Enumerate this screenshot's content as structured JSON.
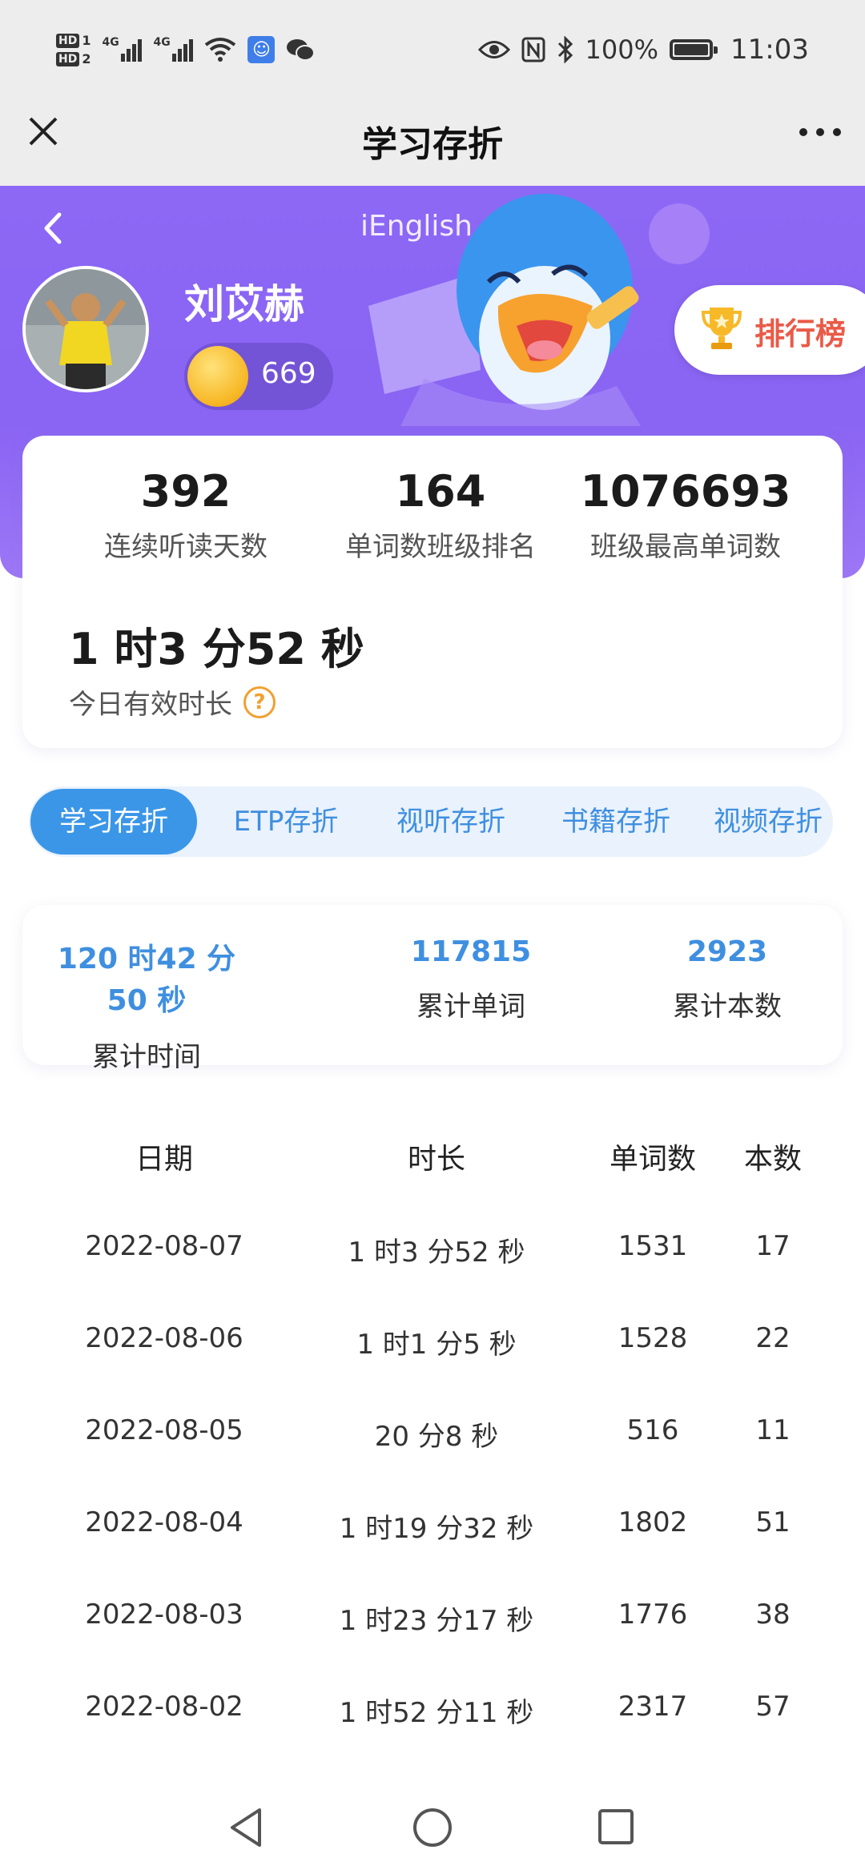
{
  "status_bar": {
    "hd1": "HD",
    "hd1_num": "1",
    "hd2": "HD",
    "hd2_num": "2",
    "net1": "4G",
    "net2": "4G",
    "battery": "100%",
    "time": "11:03"
  },
  "titlebar": {
    "title": "学习存折"
  },
  "hero": {
    "app_title": "iEnglish",
    "username": "刘苡赫",
    "coins": "669",
    "rank_label": "排行榜"
  },
  "stats": {
    "items": [
      {
        "value": "392",
        "label": "连续听读天数"
      },
      {
        "value": "164",
        "label": "单词数班级排名"
      },
      {
        "value": "1076693",
        "label": "班级最高单词数"
      }
    ],
    "today_value": "1 时3 分52 秒",
    "today_label": "今日有效时长"
  },
  "tabs": [
    "学习存折",
    "ETP存折",
    "视听存折",
    "书籍存折",
    "视频存折"
  ],
  "active_tab": "学习存折",
  "totals": [
    {
      "value": "120 时42 分50 秒",
      "label": "累计时间"
    },
    {
      "value": "117815",
      "label": "累计单词"
    },
    {
      "value": "2923",
      "label": "累计本数"
    }
  ],
  "table": {
    "headers": [
      "日期",
      "时长",
      "单词数",
      "本数"
    ],
    "rows": [
      [
        "2022-08-07",
        "1 时3 分52 秒",
        "1531",
        "17"
      ],
      [
        "2022-08-06",
        "1 时1 分5 秒",
        "1528",
        "22"
      ],
      [
        "2022-08-05",
        "20 分8 秒",
        "516",
        "11"
      ],
      [
        "2022-08-04",
        "1 时19 分32 秒",
        "1802",
        "51"
      ],
      [
        "2022-08-03",
        "1 时23 分17 秒",
        "1776",
        "38"
      ],
      [
        "2022-08-02",
        "1 时52 分11 秒",
        "2317",
        "57"
      ]
    ]
  },
  "colors": {
    "hero_purple": "#8c68f5",
    "accent_blue": "#3b96e8",
    "rank_red": "#ea5a48",
    "coin_gold": "#f7b928"
  }
}
